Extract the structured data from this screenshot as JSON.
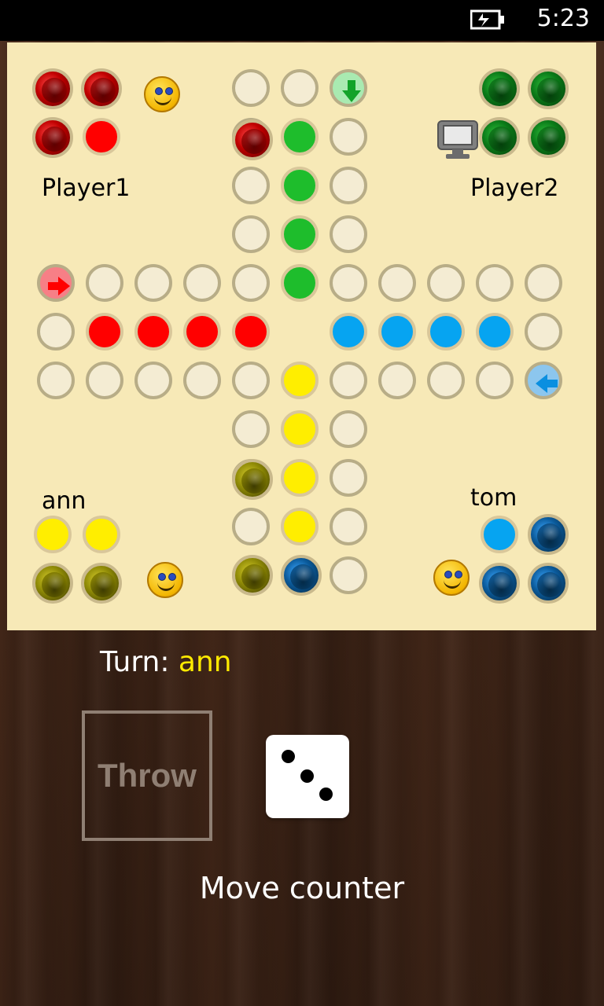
{
  "status_bar": {
    "time": "5:23",
    "battery_icon": "battery-charging-icon"
  },
  "board": {
    "players": {
      "top_left": "Player1",
      "top_right": "Player2",
      "bottom_left": "ann",
      "bottom_right": "tom"
    },
    "colors": {
      "red": "#ff0000",
      "green": "#1ebd2c",
      "blue": "#06a4f1",
      "yellow": "#ffee00",
      "board": "#f7e9b7"
    }
  },
  "turn": {
    "label": "Turn:",
    "name": "ann"
  },
  "controls": {
    "throw_label": "Throw",
    "dice_value": 3,
    "status": "Move counter"
  }
}
